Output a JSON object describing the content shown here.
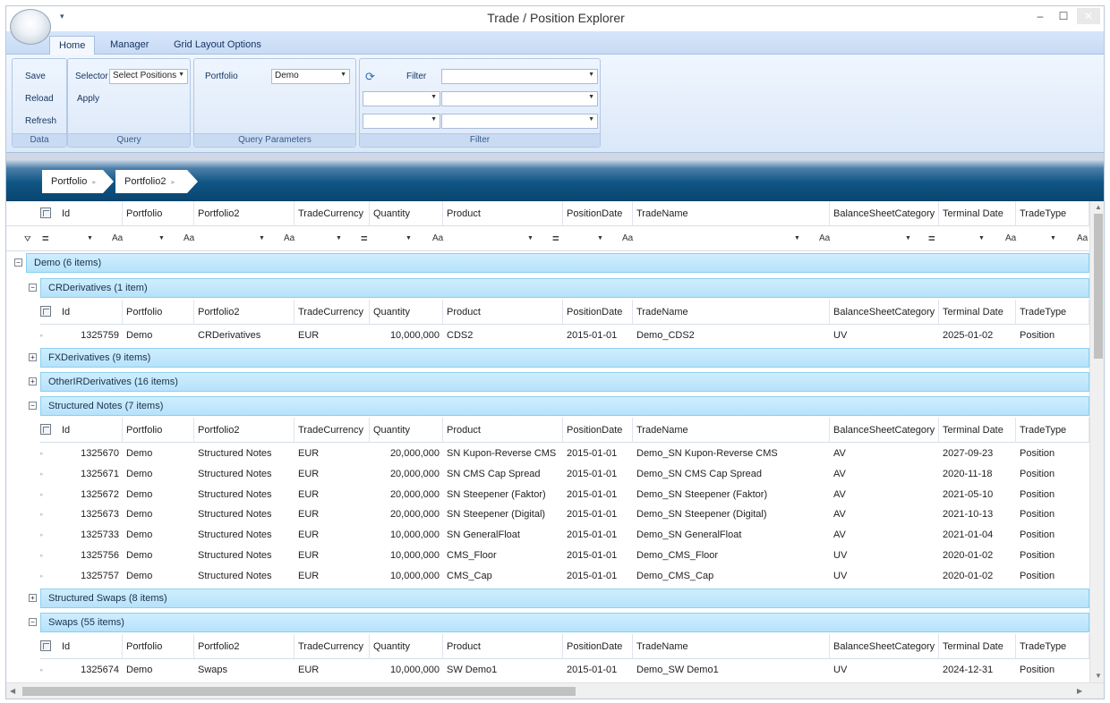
{
  "window": {
    "title": "Trade / Position Explorer",
    "qat_glyph": "▾",
    "controls": {
      "minimize": "–",
      "maximize": "☐",
      "close": "✕"
    }
  },
  "ribbon": {
    "tabs": [
      {
        "label": "Home",
        "active": true
      },
      {
        "label": "Manager",
        "active": false
      },
      {
        "label": "Grid Layout Options",
        "active": false
      }
    ],
    "groups": {
      "data": {
        "label": "Data",
        "buttons": [
          "Save",
          "Reload",
          "Refresh"
        ]
      },
      "query": {
        "label": "Query",
        "selector_label": "Selector",
        "selector_value": "Select Positions",
        "apply_label": "Apply"
      },
      "query_parameters": {
        "label": "Query Parameters",
        "portfolio_label": "Portfolio",
        "portfolio_value": "Demo"
      },
      "filter": {
        "label": "Filter",
        "filter_label": "Filter",
        "refresh_icon": "refresh-icon"
      }
    }
  },
  "breadcrumb": [
    "Portfolio",
    "Portfolio2"
  ],
  "grid": {
    "columns": [
      "Id",
      "Portfolio",
      "Portfolio2",
      "TradeCurrency",
      "Quantity",
      "Product",
      "PositionDate",
      "TradeName",
      "BalanceSheetCategory",
      "Terminal Date",
      "TradeType"
    ],
    "filter_ops": [
      "=",
      "Aa",
      "Aa",
      "Aa",
      "=",
      "Aa",
      "=",
      "Aa",
      "Aa",
      "=",
      "Aa",
      "Aa"
    ],
    "root_group": {
      "label": "Demo (6 items)"
    },
    "groups": [
      {
        "label": "CRDerivatives (1 item)",
        "expanded": true
      },
      {
        "label": "FXDerivatives (9 items)",
        "expanded": false
      },
      {
        "label": "OtherIRDerivatives (16 items)",
        "expanded": false
      },
      {
        "label": "Structured Notes (7 items)",
        "expanded": true
      },
      {
        "label": "Structured Swaps (8 items)",
        "expanded": false
      },
      {
        "label": "Swaps (55 items)",
        "expanded": true
      }
    ],
    "cr_rows": [
      [
        "1325759",
        "Demo",
        "CRDerivatives",
        "EUR",
        "10,000,000",
        "CDS2",
        "2015-01-01",
        "Demo_CDS2",
        "UV",
        "2025-01-02",
        "Position"
      ]
    ],
    "sn_rows": [
      [
        "1325670",
        "Demo",
        "Structured Notes",
        "EUR",
        "20,000,000",
        "SN Kupon-Reverse CMS",
        "2015-01-01",
        "Demo_SN Kupon-Reverse CMS",
        "AV",
        "2027-09-23",
        "Position"
      ],
      [
        "1325671",
        "Demo",
        "Structured Notes",
        "EUR",
        "20,000,000",
        "SN CMS Cap Spread",
        "2015-01-01",
        "Demo_SN CMS Cap Spread",
        "AV",
        "2020-11-18",
        "Position"
      ],
      [
        "1325672",
        "Demo",
        "Structured Notes",
        "EUR",
        "20,000,000",
        "SN Steepener (Faktor)",
        "2015-01-01",
        "Demo_SN Steepener (Faktor)",
        "AV",
        "2021-05-10",
        "Position"
      ],
      [
        "1325673",
        "Demo",
        "Structured Notes",
        "EUR",
        "20,000,000",
        "SN Steepener (Digital)",
        "2015-01-01",
        "Demo_SN Steepener (Digital)",
        "AV",
        "2021-10-13",
        "Position"
      ],
      [
        "1325733",
        "Demo",
        "Structured Notes",
        "EUR",
        "10,000,000",
        "SN GeneralFloat",
        "2015-01-01",
        "Demo_SN GeneralFloat",
        "AV",
        "2021-01-04",
        "Position"
      ],
      [
        "1325756",
        "Demo",
        "Structured Notes",
        "EUR",
        "10,000,000",
        "CMS_Floor",
        "2015-01-01",
        "Demo_CMS_Floor",
        "UV",
        "2020-01-02",
        "Position"
      ],
      [
        "1325757",
        "Demo",
        "Structured Notes",
        "EUR",
        "10,000,000",
        "CMS_Cap",
        "2015-01-01",
        "Demo_CMS_Cap",
        "UV",
        "2020-01-02",
        "Position"
      ]
    ],
    "sw_rows": [
      [
        "1325674",
        "Demo",
        "Swaps",
        "EUR",
        "10,000,000",
        "SW Demo1",
        "2015-01-01",
        "Demo_SW Demo1",
        "UV",
        "2024-12-31",
        "Position"
      ]
    ]
  }
}
